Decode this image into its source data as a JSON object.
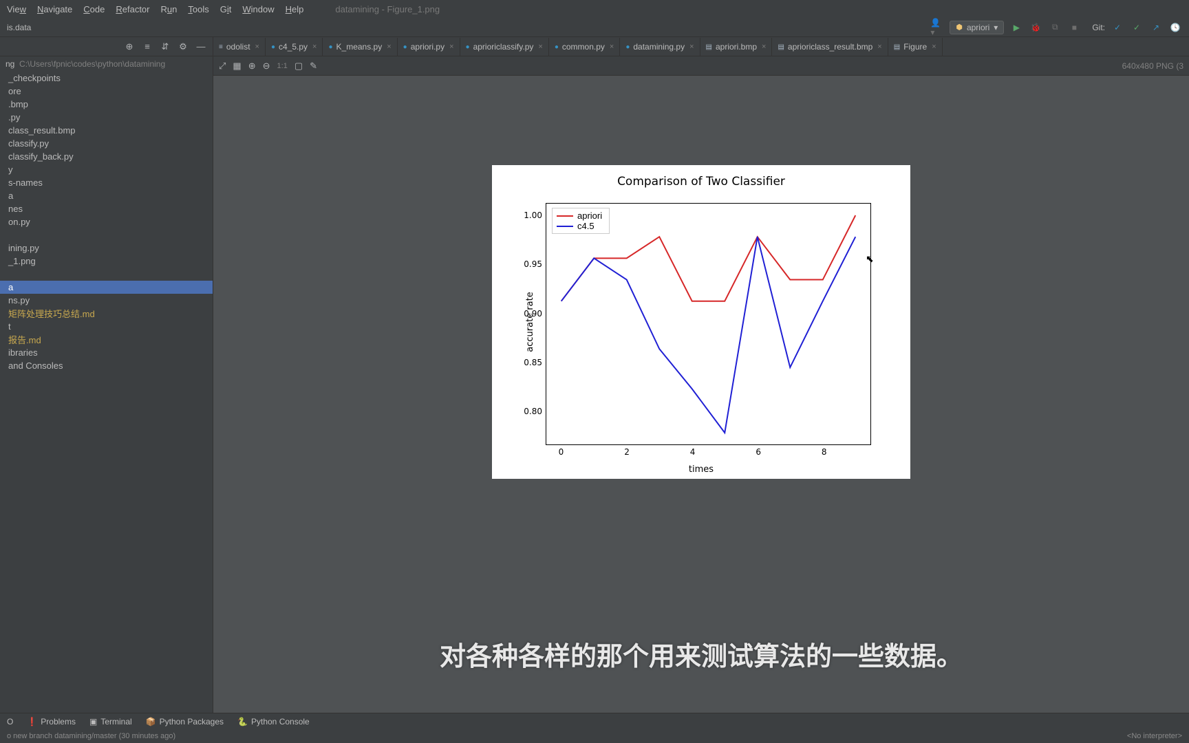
{
  "window_title": "datamining - Figure_1.png",
  "menubar": [
    "View",
    "Navigate",
    "Code",
    "Refactor",
    "Run",
    "Tools",
    "Git",
    "Window",
    "Help"
  ],
  "menubar_underline_idx": [
    3,
    0,
    0,
    0,
    0,
    0,
    2,
    0,
    0
  ],
  "breadcrumb": "is.data",
  "run_config": "apriori",
  "git_label": "Git:",
  "project_name": "ng",
  "project_path": "C:\\Users\\fpnic\\codes\\python\\datamining",
  "tree_items": [
    {
      "label": "_checkpoints",
      "yellow": false
    },
    {
      "label": "ore",
      "yellow": false
    },
    {
      "label": ".bmp",
      "yellow": false
    },
    {
      "label": ".py",
      "yellow": false
    },
    {
      "label": "class_result.bmp",
      "yellow": false
    },
    {
      "label": "classify.py",
      "yellow": false
    },
    {
      "label": "classify_back.py",
      "yellow": false
    },
    {
      "label": "y",
      "yellow": false
    },
    {
      "label": "s-names",
      "yellow": false
    },
    {
      "label": "a",
      "yellow": false
    },
    {
      "label": "nes",
      "yellow": false
    },
    {
      "label": "on.py",
      "yellow": false
    },
    {
      "label": "",
      "yellow": false
    },
    {
      "label": "ining.py",
      "yellow": false
    },
    {
      "label": "_1.png",
      "yellow": false
    },
    {
      "label": "",
      "yellow": false
    },
    {
      "label": "a",
      "yellow": false,
      "selected": true
    },
    {
      "label": "ns.py",
      "yellow": false
    },
    {
      "label": "矩阵处理技巧总结.md",
      "yellow": true
    },
    {
      "label": "t",
      "yellow": false
    },
    {
      "label": "报告.md",
      "yellow": true
    },
    {
      "label": "ibraries",
      "yellow": false
    },
    {
      "label": "and Consoles",
      "yellow": false
    }
  ],
  "tabs": [
    {
      "label": "odolist",
      "icon": "txt"
    },
    {
      "label": "c4_5.py",
      "icon": "py"
    },
    {
      "label": "K_means.py",
      "icon": "py"
    },
    {
      "label": "apriori.py",
      "icon": "py"
    },
    {
      "label": "aprioriclassify.py",
      "icon": "py"
    },
    {
      "label": "common.py",
      "icon": "py"
    },
    {
      "label": "datamining.py",
      "icon": "py"
    },
    {
      "label": "apriori.bmp",
      "icon": "img"
    },
    {
      "label": "aprioriclass_result.bmp",
      "icon": "img"
    },
    {
      "label": "Figure",
      "icon": "img"
    }
  ],
  "image_toolbar_zoom": "1:1",
  "image_info": "640x480 PNG (3",
  "subtitle": "对各种各样的那个用来测试算法的一些数据。",
  "bottom_items": [
    "O",
    "Problems",
    "Terminal",
    "Python Packages",
    "Python Console"
  ],
  "status_left": "o new branch datamining/master (30 minutes ago)",
  "status_right": "<No interpreter>",
  "chart_data": {
    "type": "line",
    "title": "Comparison of Two Classifier",
    "xlabel": "times",
    "ylabel": "accurate rate",
    "x": [
      0,
      1,
      2,
      3,
      4,
      5,
      6,
      7,
      8,
      9
    ],
    "series": [
      {
        "name": "apriori",
        "color": "#d62728",
        "values": [
          0.912,
          0.956,
          0.956,
          0.978,
          0.912,
          0.912,
          0.978,
          0.934,
          0.934,
          1.0
        ]
      },
      {
        "name": "c4.5",
        "color": "#1f1fd4",
        "values": [
          0.912,
          0.956,
          0.934,
          0.863,
          0.822,
          0.777,
          0.978,
          0.844,
          0.912,
          0.978
        ]
      }
    ],
    "yticks": [
      0.8,
      0.85,
      0.9,
      0.95,
      1.0
    ],
    "xticks": [
      0,
      2,
      4,
      6,
      8
    ],
    "xlim": [
      -0.45,
      9.45
    ],
    "ylim": [
      0.765,
      1.012
    ]
  }
}
